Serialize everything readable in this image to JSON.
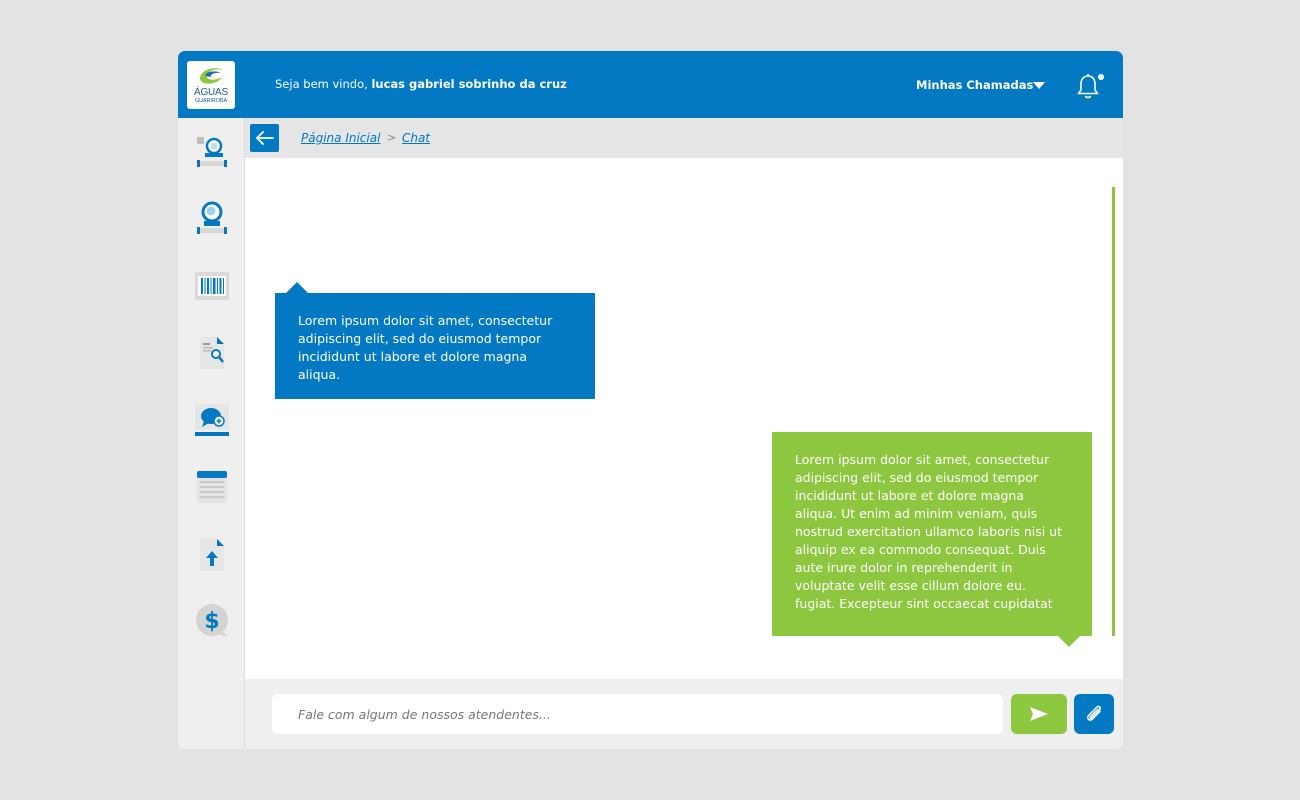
{
  "header": {
    "logo": {
      "line1": "ÁGUAS",
      "line2": "GUARIROBA"
    },
    "welcome_prefix": "Seja bem vindo,",
    "user_name": "lucas gabriel sobrinho da cruz",
    "calls_label": "Minhas Chamadas",
    "notification_icon": "bell-icon",
    "has_notification": true
  },
  "sidebar": {
    "items": [
      {
        "icon": "water-meter-icon"
      },
      {
        "icon": "water-meter-alt-icon"
      },
      {
        "icon": "barcode-icon"
      },
      {
        "icon": "document-search-icon"
      },
      {
        "icon": "chat-add-icon"
      },
      {
        "icon": "documents-stack-icon"
      },
      {
        "icon": "document-upload-icon"
      },
      {
        "icon": "dollar-icon"
      }
    ]
  },
  "breadcrumb": {
    "items": [
      "Página Inicial",
      "Chat"
    ],
    "separator": ">"
  },
  "chat": {
    "messages": [
      {
        "from": "agent",
        "text": "Lorem ipsum dolor sit amet, consectetur adipiscing elit, sed do eiusmod tempor incididunt ut labore et dolore magna aliqua."
      },
      {
        "from": "user",
        "text": "Lorem ipsum dolor sit amet, consectetur adipiscing elit, sed do eiusmod tempor incididunt ut labore et dolore magna aliqua. Ut enim ad minim veniam, quis nostrud exercitation ullamco laboris nisi ut aliquip ex ea commodo consequat. Duis aute irure dolor in reprehenderit in voluptate velit esse cillum dolore eu. fugiat. Excepteur sint occaecat cupidatat"
      }
    ]
  },
  "input": {
    "placeholder": "Fale com algum de nossos atendentes..."
  },
  "colors": {
    "primary": "#0279c2",
    "accent": "#8dc63f",
    "background": "#e3e3e3"
  }
}
